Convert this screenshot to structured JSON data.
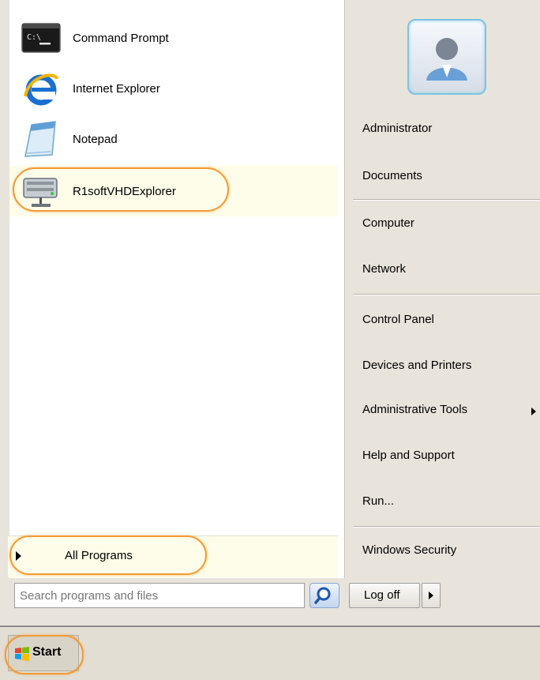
{
  "programs": [
    {
      "label": "Command Prompt",
      "icon": "command-prompt-icon"
    },
    {
      "label": "Internet Explorer",
      "icon": "internet-explorer-icon"
    },
    {
      "label": "Notepad",
      "icon": "notepad-icon"
    },
    {
      "label": "R1softVHDExplorer",
      "icon": "vhd-explorer-icon"
    }
  ],
  "all_programs_label": "All Programs",
  "search": {
    "value": "",
    "placeholder": "Search programs and files"
  },
  "right_menu": {
    "user_tile_icon": "user-avatar-icon",
    "items": [
      "Administrator",
      "Documents",
      "Computer",
      "Network",
      "Control Panel",
      "Devices and Printers",
      "Administrative Tools",
      "Help and Support",
      "Run...",
      "Windows Security"
    ]
  },
  "logoff_label": "Log off",
  "start_label": "Start",
  "colors": {
    "highlight_ring": "#f29b36",
    "selected_background": "#fdfde9",
    "menu_background": "#e8e4dc"
  }
}
